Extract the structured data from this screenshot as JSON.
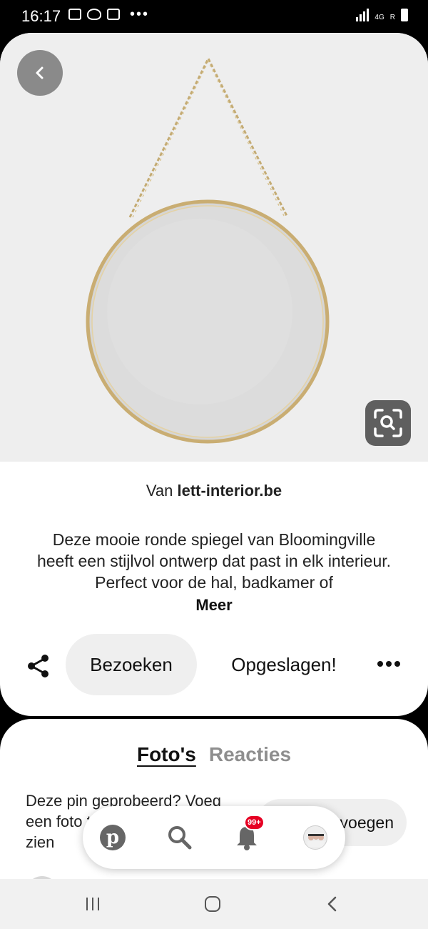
{
  "status_bar": {
    "time": "16:17",
    "left_icons": [
      "image-icon",
      "chat-icon",
      "photo-icon"
    ],
    "overflow": "•••",
    "network": "4G",
    "roaming": "R"
  },
  "pin": {
    "source_prefix": "Van",
    "source_domain": "lett-interior.be",
    "description": "Deze mooie ronde spiegel van Bloomingville heeft een stijlvol ontwerp dat past in elk interieur. Perfect voor de hal, badkamer of",
    "more_label": "Meer"
  },
  "actions": {
    "visit_label": "Bezoeken",
    "saved_label": "Opgeslagen!"
  },
  "tabs": [
    {
      "label": "Foto's",
      "active": true
    },
    {
      "label": "Reacties",
      "active": false
    }
  ],
  "tried_section": {
    "prompt": "Deze pin geprobeerd? Voeg een foto toe om het te laten zien",
    "button_label": "Toevoegen"
  },
  "bottom_nav": {
    "notification_badge": "99+"
  },
  "colors": {
    "badge": "#e60023",
    "button_bg": "#efefef",
    "image_bg": "#eeeeee"
  }
}
